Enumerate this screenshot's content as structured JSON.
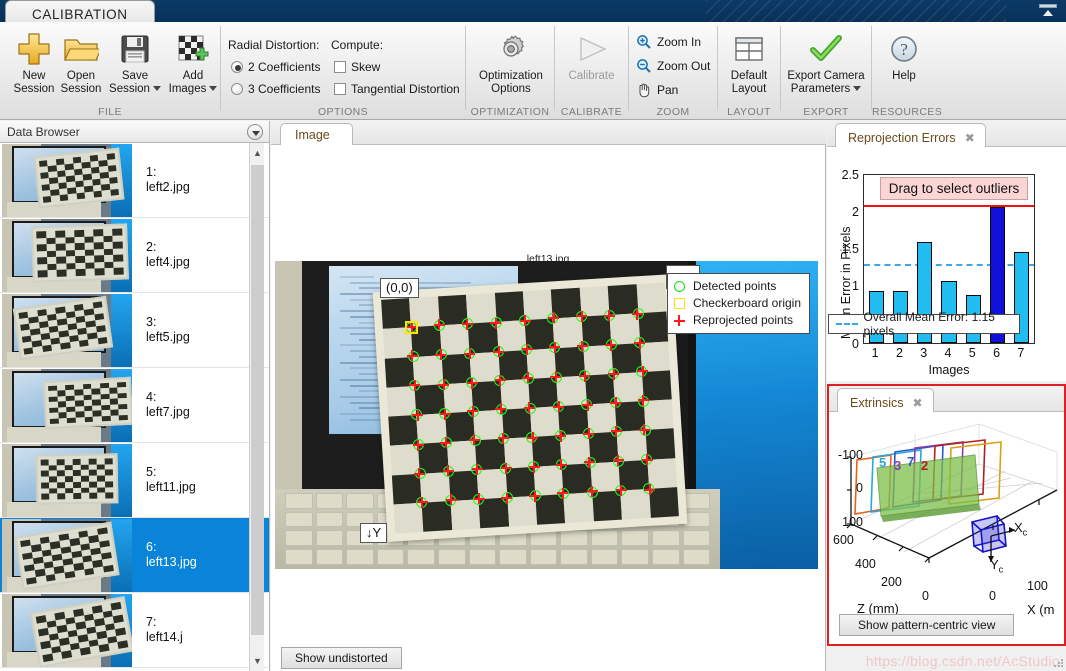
{
  "window": {
    "ribbon_tab": "CALIBRATION",
    "minimize_ribbon_icon": "collapse-ribbon-icon"
  },
  "ribbon": {
    "groups": [
      {
        "name": "FILE",
        "title": "FILE"
      },
      {
        "name": "OPTIONS",
        "title": "OPTIONS"
      },
      {
        "name": "OPTIMIZATION",
        "title": "OPTIMIZATION"
      },
      {
        "name": "CALIBRATE",
        "title": "CALIBRATE"
      },
      {
        "name": "ZOOM",
        "title": "ZOOM"
      },
      {
        "name": "LAYOUT",
        "title": "LAYOUT"
      },
      {
        "name": "EXPORT",
        "title": "EXPORT"
      },
      {
        "name": "RESOURCES",
        "title": "RESOURCES"
      }
    ],
    "file": {
      "new_session": "New\nSession",
      "new_session_l1": "New",
      "new_session_l2": "Session",
      "open_session_l1": "Open",
      "open_session_l2": "Session",
      "save_session_l1": "Save",
      "save_session_l2": "Session",
      "add_images_l1": "Add",
      "add_images_l2": "Images"
    },
    "options": {
      "radial_distortion_label": "Radial Distortion:",
      "compute_label": "Compute:",
      "radio_2_coefficients": "2 Coefficients",
      "radio_3_coefficients": "3 Coefficients",
      "radio_selected": "2 Coefficients",
      "checkbox_skew": "Skew",
      "checkbox_tangential": "Tangential Distortion",
      "skew_checked": false,
      "tangential_checked": false
    },
    "optimization": {
      "l1": "Optimization",
      "l2": "Options"
    },
    "calibrate": {
      "label": "Calibrate",
      "disabled": true
    },
    "zoom": {
      "zoom_in": "Zoom In",
      "zoom_out": "Zoom Out",
      "pan": "Pan"
    },
    "layout": {
      "l1": "Default",
      "l2": "Layout"
    },
    "export": {
      "l1": "Export Camera",
      "l2": "Parameters"
    },
    "resources": {
      "help": "Help"
    }
  },
  "data_browser": {
    "title": "Data Browser",
    "selected_index": 6,
    "items": [
      {
        "index": "1:",
        "file": "left2.jpg"
      },
      {
        "index": "2:",
        "file": "left4.jpg"
      },
      {
        "index": "3:",
        "file": "left5.jpg"
      },
      {
        "index": "4:",
        "file": "left7.jpg"
      },
      {
        "index": "5:",
        "file": "left11.jpg"
      },
      {
        "index": "6:",
        "file": "left13.jpg"
      },
      {
        "index": "7:",
        "file": "left14.j"
      }
    ]
  },
  "image_panel": {
    "tab_label": "Image",
    "image_title": "left13.jpg",
    "origin_tag": "(0,0)",
    "y_axis_tag": "↓Y",
    "show_undistorted_button": "Show undistorted",
    "legend": [
      {
        "icon": "green-circle-icon",
        "label": "Detected points"
      },
      {
        "icon": "yellow-square-icon",
        "label": "Checkerboard origin"
      },
      {
        "icon": "red-cross-icon",
        "label": "Reprojected points"
      }
    ]
  },
  "reprojection_panel": {
    "tab_label": "Reprojection Errors",
    "close_icon": "close-icon",
    "drag_hint": "Drag to select outliers",
    "mean_legend": "Overall Mean Error: 1.15 pixels"
  },
  "chart_data": {
    "type": "bar",
    "title": "",
    "xlabel": "Images",
    "ylabel": "Mean Error in Pixels",
    "categories": [
      "1",
      "2",
      "3",
      "4",
      "5",
      "6",
      "7"
    ],
    "values": [
      0.78,
      0.78,
      1.5,
      0.93,
      0.72,
      2.03,
      1.35
    ],
    "ylim": [
      0,
      2.5
    ],
    "yticks": [
      "0",
      "0.5",
      "1",
      "1.5",
      "2",
      "2.5"
    ],
    "ytick_values": [
      0,
      0.5,
      1,
      1.5,
      2,
      2.5
    ],
    "grid": false,
    "bar_color": "#21bdf0",
    "selected_bar_index": 6,
    "selected_bar_color": "#1010d8",
    "mean_error": 1.15,
    "mean_line_color": "#3aa9e8",
    "threshold_line": 2.03,
    "threshold_line_color": "#f01010",
    "legend_position": "bottom-left",
    "legend_entries": [
      "Overall Mean Error: 1.15 pixels"
    ]
  },
  "extrinsics_panel": {
    "tab_label": "Extrinsics",
    "close_icon": "close-icon",
    "button_label": "Show pattern-centric view",
    "axis_x_label": "X (m",
    "axis_z_label": "Z (mm)",
    "camera_axis_x": "X",
    "camera_axis_x_sub": "c",
    "camera_axis_y": "Y",
    "camera_axis_y_sub": "c",
    "y_ticks": [
      "-100",
      "0",
      "100"
    ],
    "z_ticks": [
      "600",
      "400",
      "200",
      "0"
    ],
    "x_ticks": [
      "0",
      "100"
    ],
    "pattern_labels": [
      "5",
      "3",
      "7",
      "2"
    ]
  },
  "watermark": {
    "text": "https://blog.csdn.net/AcStudio"
  }
}
